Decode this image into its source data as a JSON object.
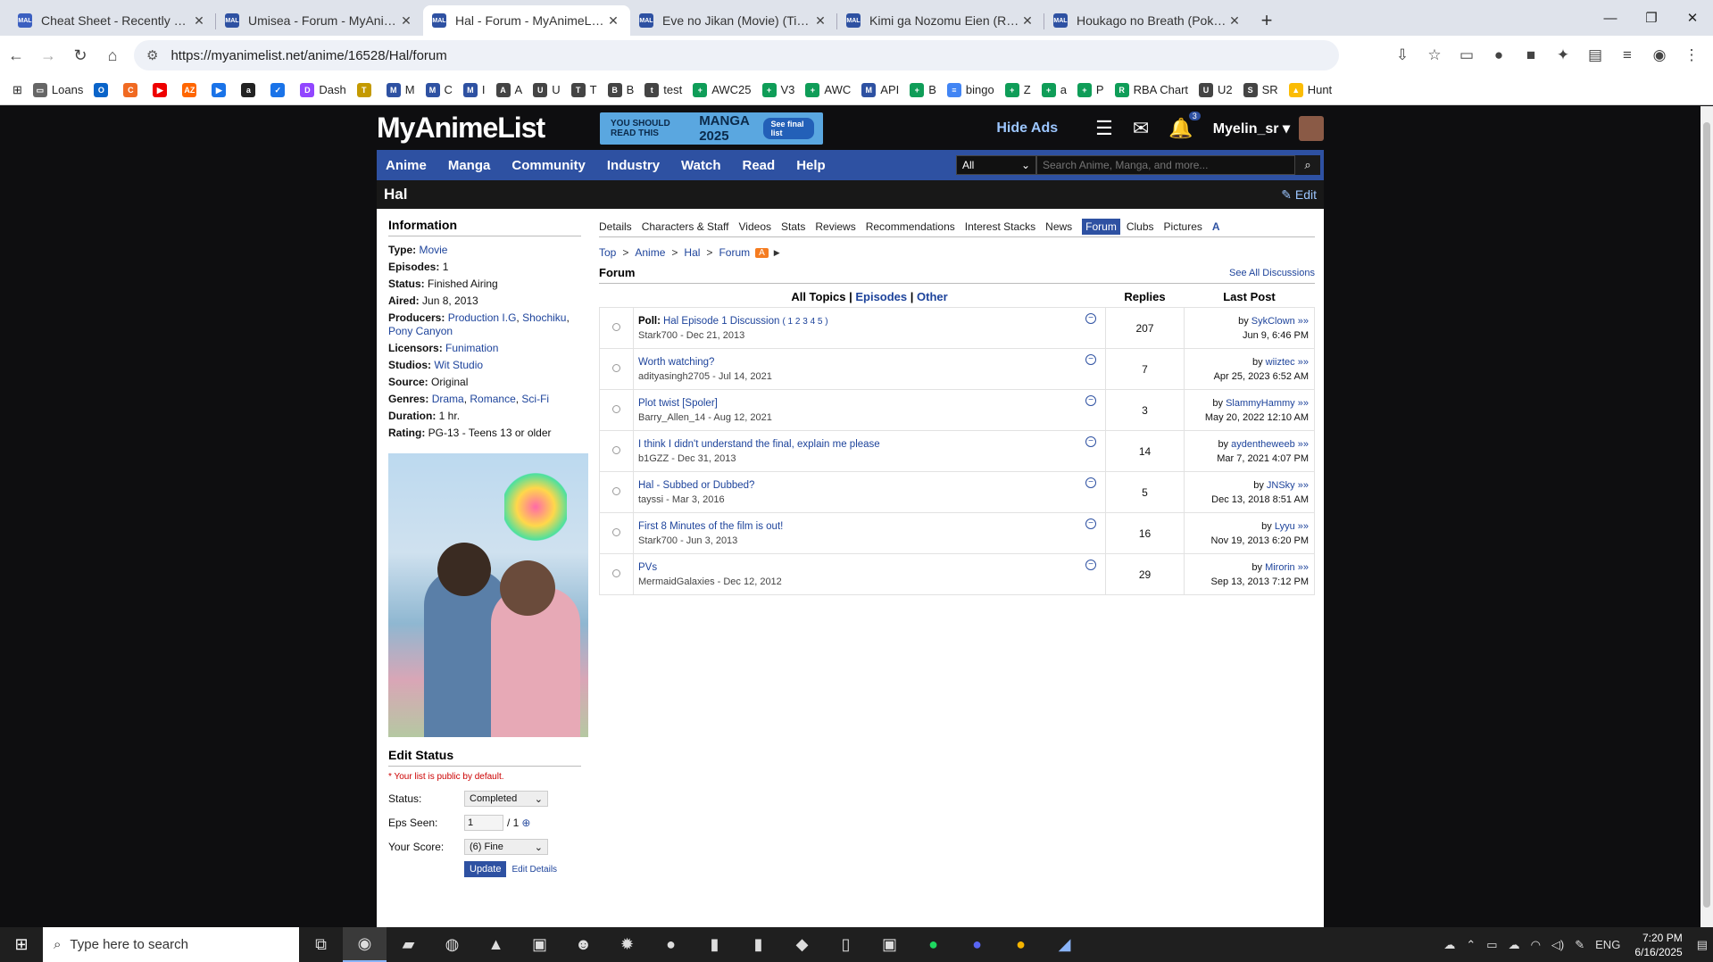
{
  "browser": {
    "tabs": [
      {
        "title": "Cheat Sheet - Recently Comple",
        "icon": "cs",
        "active": false
      },
      {
        "title": "Umisea - Forum - MyAnimeList",
        "icon": "mal",
        "active": false
      },
      {
        "title": "Hal - Forum - MyAnimeList.net",
        "icon": "mal",
        "active": true
      },
      {
        "title": "Eve no Jikan (Movie) (Time of E",
        "icon": "mal",
        "active": false
      },
      {
        "title": "Kimi ga Nozomu Eien (Rumblin",
        "icon": "mal",
        "active": false
      },
      {
        "title": "Houkago no Breath (Pokémon",
        "icon": "mal",
        "active": false
      }
    ],
    "url": "https://myanimelist.net/anime/16528/Hal/forum",
    "bookmarks": [
      "Loans",
      "",
      "",
      "",
      "",
      "",
      "",
      "",
      "Dash",
      "",
      "",
      "",
      "M",
      "C",
      "I",
      "",
      "",
      "A",
      "U",
      "T",
      "B",
      "test",
      "AWC25",
      "V3",
      "AWC",
      "API",
      "B",
      "bingo",
      "Z",
      "a",
      "P",
      "RBA Chart",
      "U2",
      "SR",
      "Hunt"
    ]
  },
  "site": {
    "logo": "MyAnimeList",
    "banner": {
      "line1": "YOU SHOULD READ THIS",
      "line2": "MANGA 2025",
      "cta": "See final list"
    },
    "hide_ads": "Hide Ads",
    "notif_count": "3",
    "username": "Myelin_sr",
    "menu": [
      "Anime",
      "Manga",
      "Community",
      "Industry",
      "Watch",
      "Read",
      "Help"
    ],
    "search": {
      "category": "All",
      "placeholder": "Search Anime, Manga, and more..."
    },
    "page_title": "Hal",
    "edit_label": "Edit"
  },
  "info": {
    "heading": "Information",
    "type_label": "Type:",
    "type": "Movie",
    "episodes_label": "Episodes:",
    "episodes": "1",
    "status_label": "Status:",
    "status": "Finished Airing",
    "aired_label": "Aired:",
    "aired": "Jun 8, 2013",
    "producers_label": "Producers:",
    "producers": [
      "Production I.G",
      "Shochiku",
      "Pony Canyon"
    ],
    "licensors_label": "Licensors:",
    "licensors": "Funimation",
    "studios_label": "Studios:",
    "studios": "Wit Studio",
    "source_label": "Source:",
    "source": "Original",
    "genres_label": "Genres:",
    "genres": [
      "Drama",
      "Romance",
      "Sci-Fi"
    ],
    "duration_label": "Duration:",
    "duration": "1 hr.",
    "rating_label": "Rating:",
    "rating": "PG-13 - Teens 13 or older"
  },
  "edit_status": {
    "heading": "Edit Status",
    "note": "* Your list is public by default.",
    "status_label": "Status:",
    "status": "Completed",
    "eps_label": "Eps Seen:",
    "eps": "1",
    "eps_total": "/ 1",
    "score_label": "Your Score:",
    "score": "(6) Fine",
    "update": "Update",
    "details": "Edit Details"
  },
  "subnav": [
    "Details",
    "Characters & Staff",
    "Videos",
    "Stats",
    "Reviews",
    "Recommendations",
    "Interest Stacks",
    "News",
    "Forum",
    "Clubs",
    "Pictures"
  ],
  "breadcrumb": [
    "Top",
    "Anime",
    "Hal",
    "Forum"
  ],
  "forum": {
    "heading": "Forum",
    "see_all": "See All Discussions",
    "tab_all": "All Topics",
    "tab_episodes": "Episodes",
    "tab_other": "Other",
    "col_replies": "Replies",
    "col_last": "Last Post",
    "topics": [
      {
        "prefix": "Poll:",
        "title": "Hal Episode 1 Discussion",
        "pages": "( 1 2 3 4 5 )",
        "author": "Stark700 - Dec 21, 2013",
        "replies": "207",
        "last_user": "SykClown",
        "last_date": "Jun 9, 6:46 PM"
      },
      {
        "prefix": "",
        "title": "Worth watching?",
        "pages": "",
        "author": "adityasingh2705 - Jul 14, 2021",
        "replies": "7",
        "last_user": "wiiztec",
        "last_date": "Apr 25, 2023 6:52 AM"
      },
      {
        "prefix": "",
        "title": "Plot twist [Spoler]",
        "pages": "",
        "author": "Barry_Allen_14 - Aug 12, 2021",
        "replies": "3",
        "last_user": "SlammyHammy",
        "last_date": "May 20, 2022 12:10 AM"
      },
      {
        "prefix": "",
        "title": "I think I didn't understand the final, explain me please",
        "pages": "",
        "author": "b1GZZ - Dec 31, 2013",
        "replies": "14",
        "last_user": "aydentheweeb",
        "last_date": "Mar 7, 2021 4:07 PM"
      },
      {
        "prefix": "",
        "title": "Hal - Subbed or Dubbed?",
        "pages": "",
        "author": "tayssi - Mar 3, 2016",
        "replies": "5",
        "last_user": "JNSky",
        "last_date": "Dec 13, 2018 8:51 AM"
      },
      {
        "prefix": "",
        "title": "First 8 Minutes of the film is out!",
        "pages": "",
        "author": "Stark700 - Jun 3, 2013",
        "replies": "16",
        "last_user": "Lyyu",
        "last_date": "Nov 19, 2013 6:20 PM"
      },
      {
        "prefix": "",
        "title": "PVs",
        "pages": "",
        "author": "MermaidGalaxies - Dec 12, 2012",
        "replies": "29",
        "last_user": "Mirorin",
        "last_date": "Sep 13, 2013 7:12 PM"
      }
    ]
  },
  "taskbar": {
    "search_placeholder": "Type here to search",
    "lang": "ENG",
    "time": "7:20 PM",
    "date": "6/16/2025"
  }
}
